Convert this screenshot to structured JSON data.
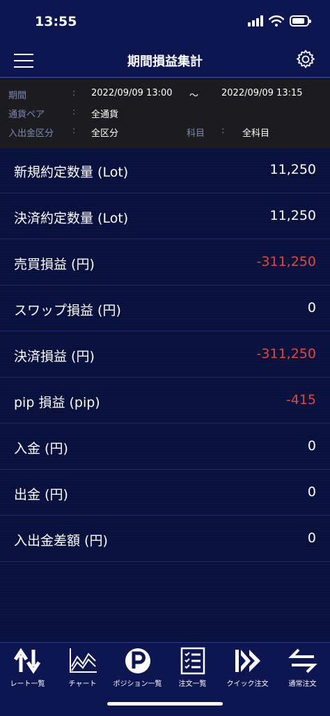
{
  "status": {
    "time": "13:55"
  },
  "nav": {
    "title": "期間損益集計"
  },
  "filter": {
    "period_label": "期間",
    "period_start": "2022/09/09 13:00",
    "period_sep": "〜",
    "period_end": "2022/09/09 13:15",
    "pair_label": "通貨ペア",
    "pair_value": "全通貨",
    "io_label": "入出金区分",
    "io_value": "全区分",
    "subject_label": "科目",
    "subject_value": "全科目",
    "colon": ":"
  },
  "rows": [
    {
      "label": "新規約定数量 (Lot)",
      "value": "11,250",
      "negative": false
    },
    {
      "label": "決済約定数量 (Lot)",
      "value": "11,250",
      "negative": false
    },
    {
      "label": "売買損益 (円)",
      "value": "-311,250",
      "negative": true
    },
    {
      "label": "スワップ損益 (円)",
      "value": "0",
      "negative": false
    },
    {
      "label": "決済損益 (円)",
      "value": "-311,250",
      "negative": true
    },
    {
      "label": "pip 損益 (pip)",
      "value": "-415",
      "negative": true
    },
    {
      "label": "入金 (円)",
      "value": "0",
      "negative": false
    },
    {
      "label": "出金 (円)",
      "value": "0",
      "negative": false
    },
    {
      "label": "入出金差額 (円)",
      "value": "0",
      "negative": false
    }
  ],
  "tabs": [
    {
      "label": "レート一覧",
      "icon": "rate-arrows-icon"
    },
    {
      "label": "チャート",
      "icon": "chart-icon"
    },
    {
      "label": "ポジション一覧",
      "icon": "position-p-icon"
    },
    {
      "label": "注文一覧",
      "icon": "order-list-icon"
    },
    {
      "label": "クイック注文",
      "icon": "quick-order-icon"
    },
    {
      "label": "通常注文",
      "icon": "normal-order-icon"
    }
  ],
  "colors": {
    "negative": "#e04a3f",
    "background": "#0a1030",
    "bar": "#0d1650"
  }
}
